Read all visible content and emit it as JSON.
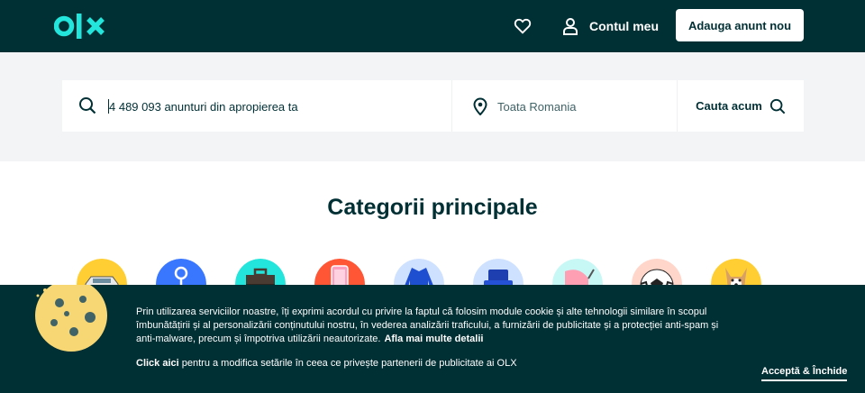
{
  "header": {
    "logo_text": "olx",
    "account_label": "Contul meu",
    "post_button": "Adauga anunt nou"
  },
  "search": {
    "query_placeholder": "4 489 093 anunturi din apropierea ta",
    "location_placeholder": "Toata Romania",
    "button_label": "Cauta acum"
  },
  "categories": {
    "title": "Categorii principale",
    "items": [
      {
        "icon": "car-icon",
        "color": "#ffce32"
      },
      {
        "icon": "real-estate-keys-icon",
        "color": "#3a77ff"
      },
      {
        "icon": "briefcase-icon",
        "color": "#23e5db"
      },
      {
        "icon": "phone-icon",
        "color": "#ff5636"
      },
      {
        "icon": "fashion-icon",
        "color": "#cee1ff"
      },
      {
        "icon": "armchair-icon",
        "color": "#cee1ff"
      },
      {
        "icon": "stroller-icon",
        "color": "#c8f8f6"
      },
      {
        "icon": "football-icon",
        "color": "#ffd6c9"
      },
      {
        "icon": "dog-icon",
        "color": "#ffce32"
      }
    ]
  },
  "cookie": {
    "text": "Prin utilizarea serviciilor noastre, îți exprimi acordul cu privire la faptul că folosim module cookie și alte tehnologii similare în scopul îmbunătățirii și al personalizării conținutului nostru, în vederea analizării traficului, a furnizării de publicitate și a protecției anti-spam și anti-malware, precum și împotriva utilizării neautorizate.",
    "more_link": "Afla mai multe detalii",
    "click_here": "Click aici",
    "second_text": "pentru a modifica setările în ceea ce privește partenerii de publicitate ai OLX",
    "accept_label": "Acceptă & Închide"
  },
  "colors": {
    "primary": "#002f34",
    "accent": "#23e5db",
    "band": "#f2f4f5"
  }
}
